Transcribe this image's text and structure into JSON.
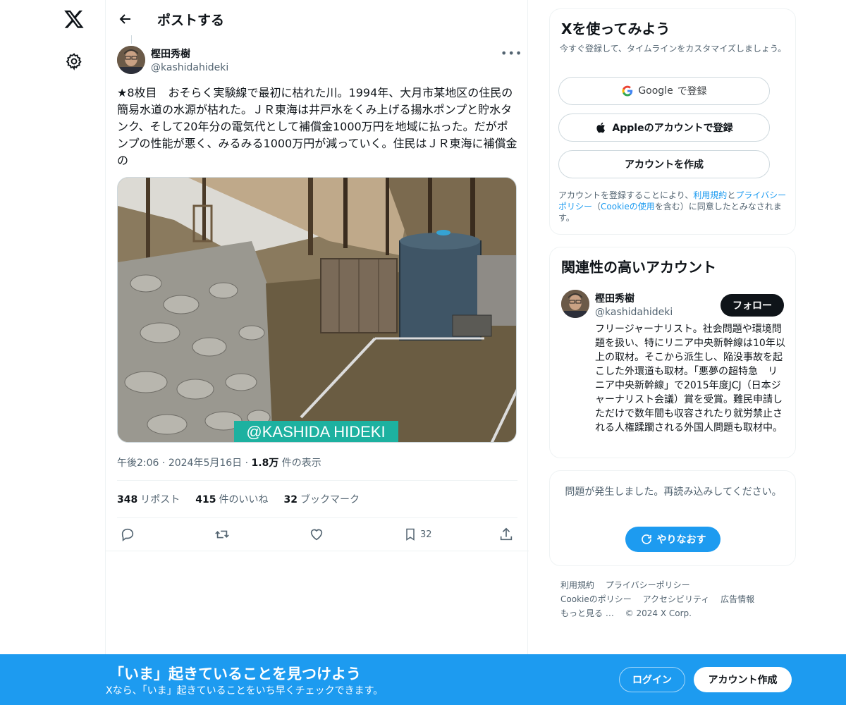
{
  "colors": {
    "accent": "#1d9bf0",
    "text": "#0f1419",
    "muted": "#536471",
    "border": "#eff3f4"
  },
  "header": {
    "title": "ポストする"
  },
  "post": {
    "author_name": "樫田秀樹",
    "author_handle": "@kashidahideki",
    "text": "★8枚目　おそらく実験線で最初に枯れた川。1994年、大月市某地区の住民の簡易水道の水源が枯れた。ＪＲ東海は井戸水をくみ上げる揚水ポンプと貯水タンク、そして20年分の電気代として補償金1000万円を地域に払った。だがポンプの性能が悪く、みるみる1000万円が減っていく。住民はＪＲ東海に補償金の",
    "image_watermark": "@KASHIDA HIDEKI",
    "time": "午後2:06",
    "date": "2024年5月16日",
    "views_count": "1.8万",
    "views_label": "件の表示",
    "reposts_count": "348",
    "reposts_label": "リポスト",
    "likes_count": "415",
    "likes_label": "件のいいね",
    "bookmarks_count": "32",
    "bookmarks_label": "ブックマーク",
    "bookmark_action_count": "32"
  },
  "signup_card": {
    "title": "Xを使ってみよう",
    "subtitle": "今すぐ登録して、タイムラインをカスタマイズしましょう。",
    "google_word": "Google",
    "google_suffix": "で登録",
    "apple_label": "Appleのアカウントで登録",
    "create_label": "アカウントを作成",
    "legal_prefix": "アカウントを登録することにより、",
    "legal_terms": "利用規約",
    "legal_and": "と",
    "legal_privacy": "プライバシーポリシー",
    "legal_open": "（",
    "legal_cookie": "Cookieの使用",
    "legal_suffix": "を含む）に同意したとみなされます。"
  },
  "related": {
    "title": "関連性の高いアカウント",
    "name": "樫田秀樹",
    "handle": "@kashidahideki",
    "follow_label": "フォロー",
    "bio": "フリージャーナリスト。社会問題や環境問題を扱い、特にリニア中央新幹線は10年以上の取材。そこから派生し、陥没事故を起こした外環道も取材。「悪夢の超特急　リニア中央新幹線」で2015年度JCJ（日本ジャーナリスト会議）賞を受賞。難民申請しただけで数年間も収容されたり就労禁止される人権蹂躙される外国人問題も取材中。"
  },
  "error_card": {
    "message": "問題が発生しました。再読み込みしてください。",
    "retry_label": "やりなおす"
  },
  "footer": {
    "links": [
      "利用規約",
      "プライバシーポリシー",
      "Cookieのポリシー",
      "アクセシビリティ",
      "広告情報",
      "もっと見る …"
    ],
    "copyright": "© 2024 X Corp."
  },
  "banner": {
    "title": "「いま」起きていることを見つけよう",
    "subtitle": "Xなら、「いま」起きていることをいち早くチェックできます。",
    "login_label": "ログイン",
    "signup_label": "アカウント作成"
  }
}
